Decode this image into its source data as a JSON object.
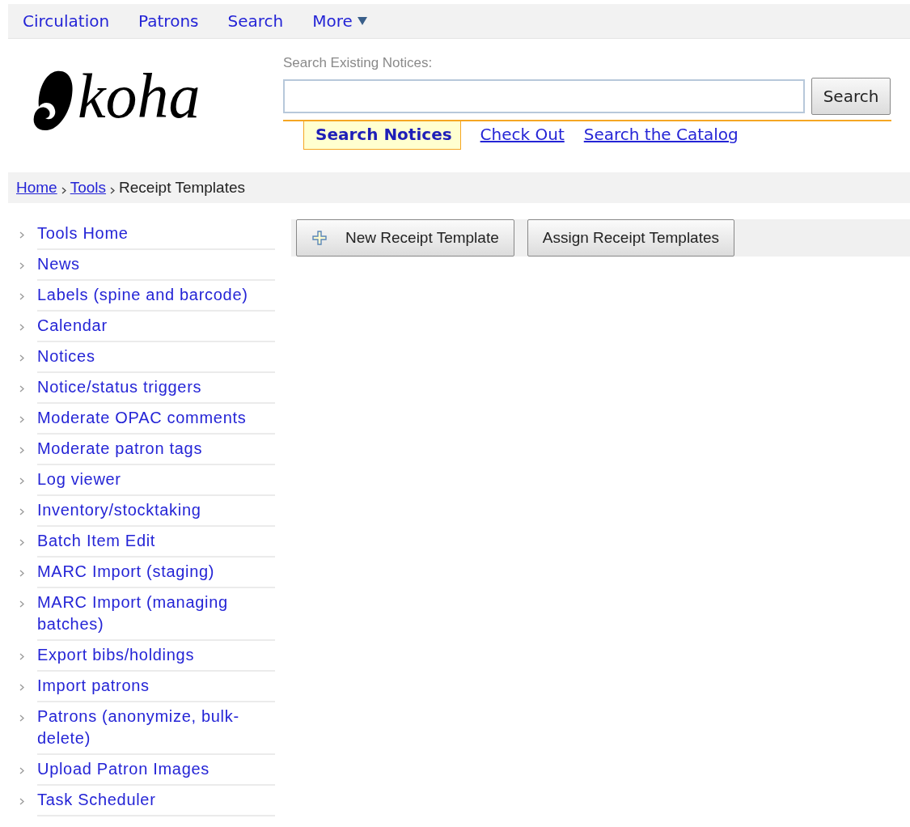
{
  "top_nav": [
    {
      "label": "Circulation",
      "has_menu": false
    },
    {
      "label": "Patrons",
      "has_menu": false
    },
    {
      "label": "Search",
      "has_menu": false
    },
    {
      "label": "More",
      "has_menu": true
    }
  ],
  "logo": {
    "text": "koha"
  },
  "search": {
    "label": "Search Existing Notices:",
    "button": "Search"
  },
  "search_tabs": [
    {
      "label": "Search Notices",
      "selected": true
    },
    {
      "label": "Check Out",
      "selected": false
    },
    {
      "label": "Search the Catalog",
      "selected": false
    }
  ],
  "breadcrumb": [
    {
      "label": "Home",
      "link": true
    },
    {
      "label": "Tools",
      "link": true
    },
    {
      "label": "Receipt Templates",
      "link": false
    }
  ],
  "sidebar": {
    "items": [
      {
        "label": "Tools Home"
      },
      {
        "label": "News"
      },
      {
        "label": "Labels (spine and barcode)"
      },
      {
        "label": "Calendar"
      },
      {
        "label": "Notices"
      },
      {
        "label": "Notice/status triggers"
      },
      {
        "label": "Moderate OPAC comments"
      },
      {
        "label": "Moderate patron tags"
      },
      {
        "label": "Log viewer"
      },
      {
        "label": "Inventory/stocktaking"
      },
      {
        "label": "Batch Item Edit"
      },
      {
        "label": "MARC Import (staging)"
      },
      {
        "label": "MARC Import (managing batches)"
      },
      {
        "label": "Export bibs/holdings"
      },
      {
        "label": "Import patrons"
      },
      {
        "label": "Patrons (anonymize, bulk-delete)"
      },
      {
        "label": "Upload Patron Images"
      },
      {
        "label": "Task Scheduler"
      }
    ]
  },
  "toolbar": [
    {
      "label": "New Receipt Template",
      "kind": "add"
    },
    {
      "label": "Assign Receipt Templates",
      "kind": "plain"
    }
  ]
}
